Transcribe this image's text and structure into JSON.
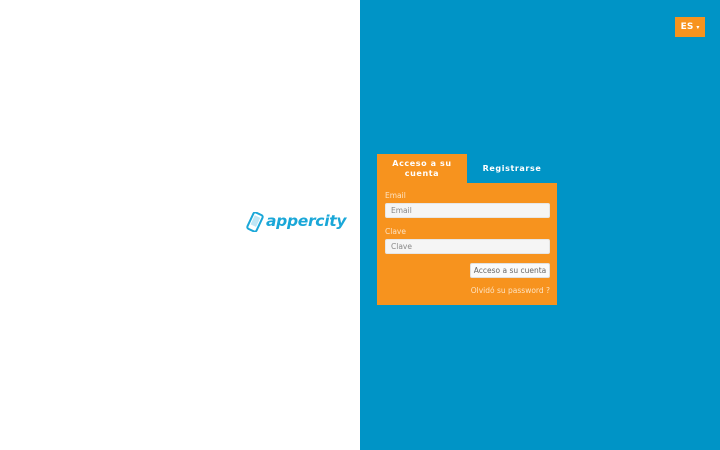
{
  "brand": {
    "name": "appercity",
    "logo_icon": "phone-icon"
  },
  "language": {
    "current": "ES",
    "caret": "▾"
  },
  "tabs": {
    "login": "Acceso a su cuenta",
    "register": "Registrarse"
  },
  "login_form": {
    "email_label": "Email",
    "email_placeholder": "Email",
    "password_label": "Clave",
    "password_placeholder": "Clave",
    "submit_label": "Acceso a su cuenta",
    "forgot_label": "Olvidó su password ?"
  },
  "colors": {
    "accent_orange": "#f7931e",
    "panel_blue": "#0094c6",
    "logo_blue": "#1aa7d8"
  }
}
